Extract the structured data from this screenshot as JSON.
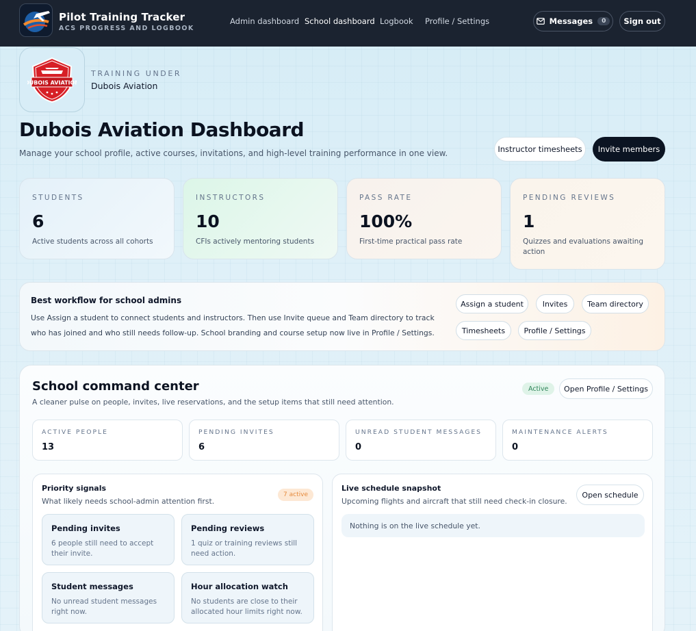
{
  "app": {
    "title": "Pilot Training Tracker",
    "subtitle": "ACS PROGRESS AND LOGBOOK"
  },
  "nav": {
    "links": [
      "Admin dashboard",
      "School dashboard",
      "Logbook",
      "Profile / Settings"
    ],
    "active": "School dashboard",
    "messages_label": "Messages",
    "messages_count": "0",
    "signout_label": "Sign out"
  },
  "school": {
    "eyebrow": "TRAINING UNDER",
    "name": "Dubois Aviation",
    "logo_text": "DUBOIS AVIATION"
  },
  "header": {
    "title": "Dubois Aviation Dashboard",
    "subtitle": "Manage your school profile, active courses, invitations, and high-level training performance in one view.",
    "btn_timesheets": "Instructor timesheets",
    "btn_invite": "Invite members"
  },
  "stats": [
    {
      "label": "STUDENTS",
      "value": "6",
      "desc": "Active students across all cohorts",
      "bg": "#eaf4fa"
    },
    {
      "label": "INSTRUCTORS",
      "value": "10",
      "desc": "CFIs actively mentoring students",
      "bg": "#e5f7ee"
    },
    {
      "label": "PASS RATE",
      "value": "100%",
      "desc": "First-time practical pass rate",
      "bg": "#f8f1ea"
    },
    {
      "label": "PENDING REVIEWS",
      "value": "1",
      "desc": "Quizzes and evaluations awaiting action",
      "bg": "#fbf3ea"
    }
  ],
  "workflow": {
    "title": "Best workflow for school admins",
    "text": "Use Assign a student to connect students and instructors. Then use Invite queue and Team directory to track who has joined and who still needs follow-up. School branding and course setup now live in Profile / Settings.",
    "chips": [
      "Assign a student",
      "Invites",
      "Team directory",
      "Timesheets",
      "Profile / Settings"
    ]
  },
  "command": {
    "title": "School command center",
    "subtitle": "A cleaner pulse on people, invites, live reservations, and the setup items that still need attention.",
    "status": "Active",
    "btn_settings": "Open Profile / Settings",
    "metrics": [
      {
        "label": "ACTIVE PEOPLE",
        "value": "13"
      },
      {
        "label": "PENDING INVITES",
        "value": "6"
      },
      {
        "label": "UNREAD STUDENT MESSAGES",
        "value": "0"
      },
      {
        "label": "MAINTENANCE ALERTS",
        "value": "0"
      }
    ]
  },
  "priority": {
    "title": "Priority signals",
    "subtitle": "What likely needs school-admin attention first.",
    "badge": "7 active",
    "cards": [
      {
        "title": "Pending invites",
        "desc": "6 people still need to accept their invite."
      },
      {
        "title": "Pending reviews",
        "desc": "1 quiz or training reviews still need action."
      },
      {
        "title": "Student messages",
        "desc": "No unread student messages right now."
      },
      {
        "title": "Hour allocation watch",
        "desc": "No students are close to their allocated hour limits right now."
      }
    ]
  },
  "schedule": {
    "title": "Live schedule snapshot",
    "subtitle": "Upcoming flights and aircraft that still need check-in closure.",
    "btn": "Open schedule",
    "empty": "Nothing is on the live schedule yet."
  }
}
